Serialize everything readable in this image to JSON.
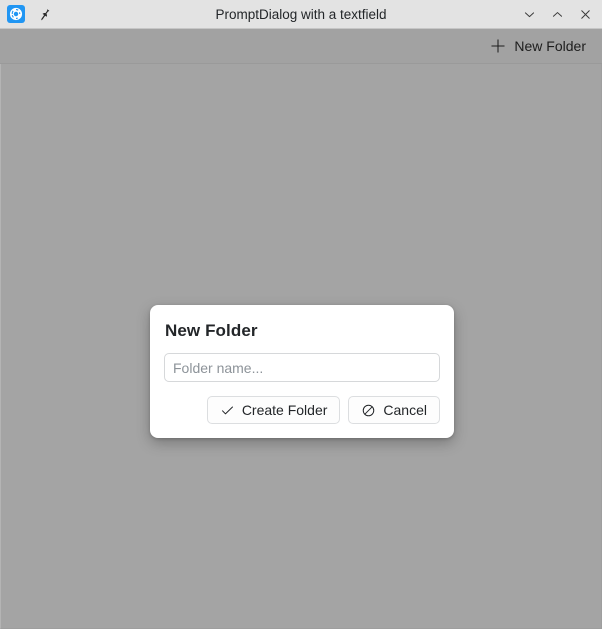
{
  "window": {
    "title": "PromptDialog with a textfield",
    "titlebar_left_buttons": [
      {
        "name": "kde-logo-icon",
        "label": "K"
      },
      {
        "name": "keep-above-pin-icon",
        "label": ""
      }
    ],
    "controls": [
      {
        "name": "minimize-button",
        "icon": "chevron-down-icon"
      },
      {
        "name": "maximize-button",
        "icon": "chevron-up-icon"
      },
      {
        "name": "close-button",
        "icon": "close-icon"
      }
    ]
  },
  "header": {
    "new_folder_label": "New Folder",
    "new_folder_icon": "plus-icon"
  },
  "dialog": {
    "title": "New Folder",
    "input": {
      "value": "",
      "placeholder": "Folder name..."
    },
    "buttons": [
      {
        "label": "Create Folder",
        "icon": "check-icon"
      },
      {
        "label": "Cancel",
        "icon": "block-icon"
      }
    ]
  },
  "colors": {
    "titlebar_bg": "#e3e3e3",
    "header_bg": "#a2a2a2",
    "content_bg": "#a4a4a4",
    "dialog_bg": "#ffffff",
    "accent": "#2196f3",
    "text": "#232629",
    "placeholder": "#8d9399"
  }
}
